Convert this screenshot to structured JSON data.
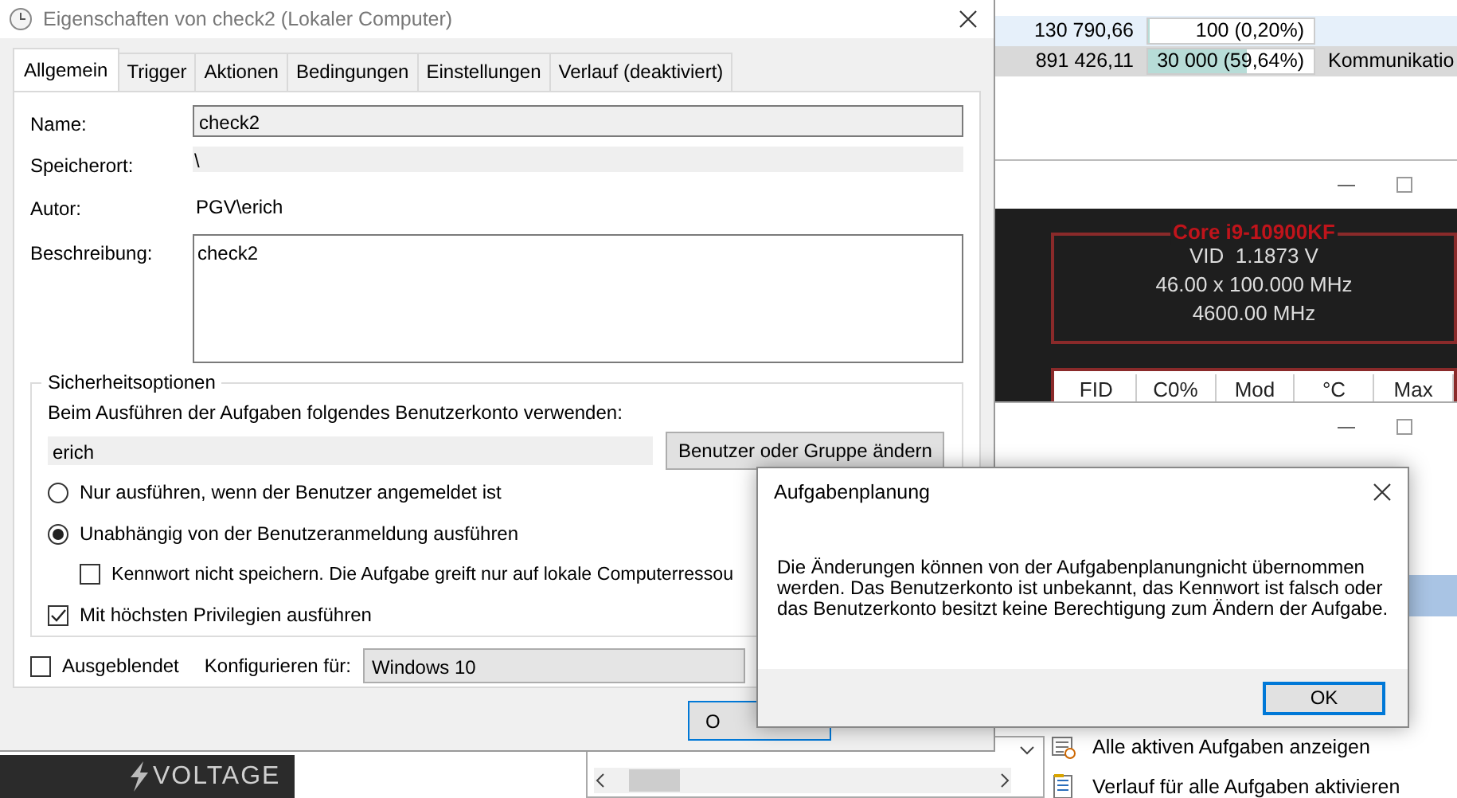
{
  "spreadsheet": {
    "rows": [
      {
        "column_1": "130 790,66",
        "column_2": "100 (0,20%)",
        "level": 0.002,
        "selected": false
      },
      {
        "column_1": "891 426,11",
        "column_2": "30 000 (59,64%)",
        "level": 0.6,
        "column_3": "Kommunikatio",
        "selected": true
      }
    ]
  },
  "cpu_monitor": {
    "cpu": "Core i9-10900KF",
    "lines": [
      "VID  1.1873 V",
      "46.00 x 100.000 MHz",
      "4600.00 MHz"
    ],
    "columns": [
      "FID",
      "C0%",
      "Mod",
      "°C",
      "Max"
    ]
  },
  "actions_pane": {
    "items": [
      {
        "label": "Alle aktiven Aufgaben anzeigen"
      },
      {
        "label": "Verlauf für alle Aufgaben aktivieren"
      }
    ]
  },
  "logo": {
    "text": "VOLTAGE"
  },
  "window": {
    "title": "Eigenschaften von check2 (Lokaler Computer)"
  },
  "tabs": [
    {
      "label": "Allgemein",
      "selected": true
    },
    {
      "label": "Trigger",
      "selected": false
    },
    {
      "label": "Aktionen",
      "selected": false
    },
    {
      "label": "Bedingungen",
      "selected": false
    },
    {
      "label": "Einstellungen",
      "selected": false
    },
    {
      "label": "Verlauf (deaktiviert)",
      "selected": false
    }
  ],
  "fields": [
    {
      "label": "Name:",
      "value": "check2",
      "kind": "input"
    },
    {
      "label": "Speicherort:",
      "value": "\\",
      "kind": "readonly"
    },
    {
      "label": "Autor:",
      "value": "PGV\\erich",
      "kind": "text"
    },
    {
      "label": "Beschreibung:",
      "value": "check2",
      "kind": "textarea"
    }
  ],
  "security": {
    "title": "Sicherheitsoptionen",
    "account_label": "Beim Ausführen der Aufgaben folgendes Benutzerkonto verwenden:",
    "account": "erich",
    "change_button": "Benutzer oder Gruppe ändern",
    "options": [
      {
        "kind": "radio",
        "label": "Nur ausführen, wenn der Benutzer angemeldet ist",
        "selected": false
      },
      {
        "kind": "radio",
        "label": "Unabhängig von der Benutzeranmeldung ausführen",
        "selected": true
      },
      {
        "kind": "checkbox",
        "label": "Kennwort nicht speichern. Die Aufgabe greift nur auf lokale Computerressou",
        "checked": false,
        "indented": true
      },
      {
        "kind": "checkbox",
        "label": "Mit höchsten Privilegien ausführen",
        "checked": true,
        "indented": false
      }
    ]
  },
  "hidden_option": {
    "label": "Ausgeblendet",
    "checked": false
  },
  "configure": {
    "label": "Konfigurieren für:",
    "value": "Windows 10"
  },
  "ok_button": "O",
  "message_box": {
    "title": "Aufgabenplanung",
    "text": "Die Änderungen können von der Aufgabenplanungnicht übernommen werden. Das Benutzerkonto ist unbekannt, das Kennwort ist falsch oder das Benutzerkonto besitzt keine Berechtigung zum Ändern der Aufgabe.",
    "button": "OK"
  }
}
